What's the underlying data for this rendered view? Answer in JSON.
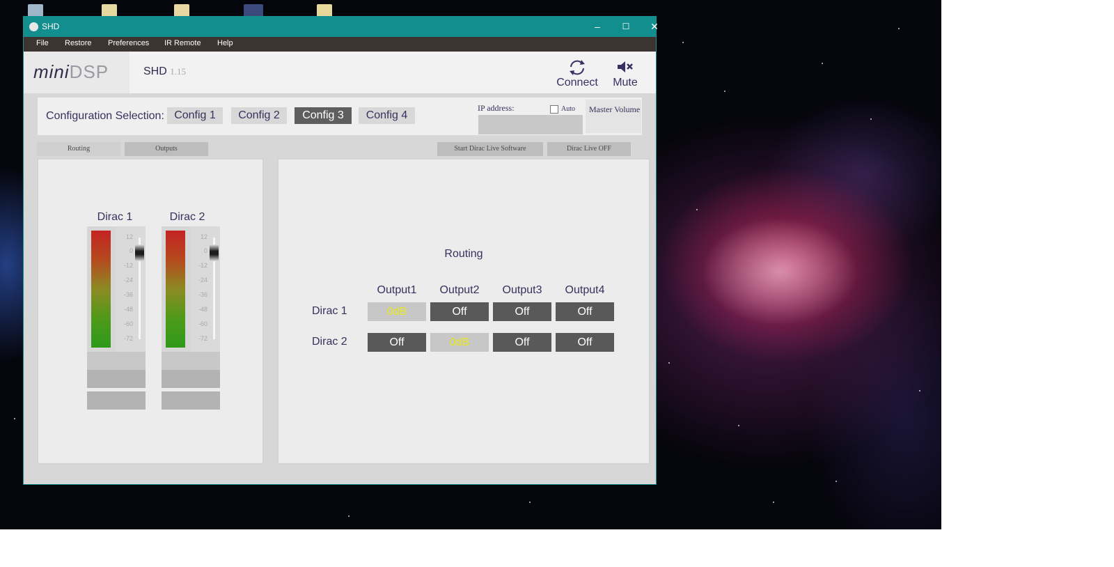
{
  "window": {
    "title": "SHD",
    "controls": {
      "minimize": "–",
      "maximize": "☐",
      "close": "✕"
    }
  },
  "menu": {
    "items": [
      "File",
      "Restore",
      "Preferences",
      "IR Remote",
      "Help"
    ]
  },
  "header": {
    "logo_main": "mini",
    "logo_dsp": "DSP",
    "product": "SHD",
    "version": "1.15",
    "connect_label": "Connect",
    "mute_label": "Mute",
    "connect_icon": "refresh-icon",
    "mute_icon": "speaker-mute-icon"
  },
  "config": {
    "label": "Configuration Selection:",
    "options": [
      "Config 1",
      "Config 2",
      "Config 3",
      "Config 4"
    ],
    "active": "Config 3",
    "ip_label": "IP address:",
    "ip_value": "",
    "auto_label": "Auto",
    "auto_checked": false,
    "master_volume_label": "Master Volume"
  },
  "tabs": {
    "routing": "Routing",
    "outputs": "Outputs",
    "start_dirac": "Start Dirac Live Software",
    "dirac_status": "Dirac Live OFF"
  },
  "meters": {
    "channels": [
      "Dirac 1",
      "Dirac 2"
    ],
    "scale": [
      "12",
      "0",
      "-12",
      "-24",
      "-36",
      "-48",
      "-60",
      "-72"
    ],
    "meter_color_top": "#c42323",
    "meter_color_bottom": "#2e9a1a"
  },
  "routing": {
    "title": "Routing",
    "outputs": [
      "Output1",
      "Output2",
      "Output3",
      "Output4"
    ],
    "rows": [
      {
        "label": "Dirac 1",
        "cells": [
          "0dB",
          "Off",
          "Off",
          "Off"
        ]
      },
      {
        "label": "Dirac 2",
        "cells": [
          "Off",
          "0dB",
          "Off",
          "Off"
        ]
      }
    ],
    "on_text_color": "#e8e81a"
  }
}
